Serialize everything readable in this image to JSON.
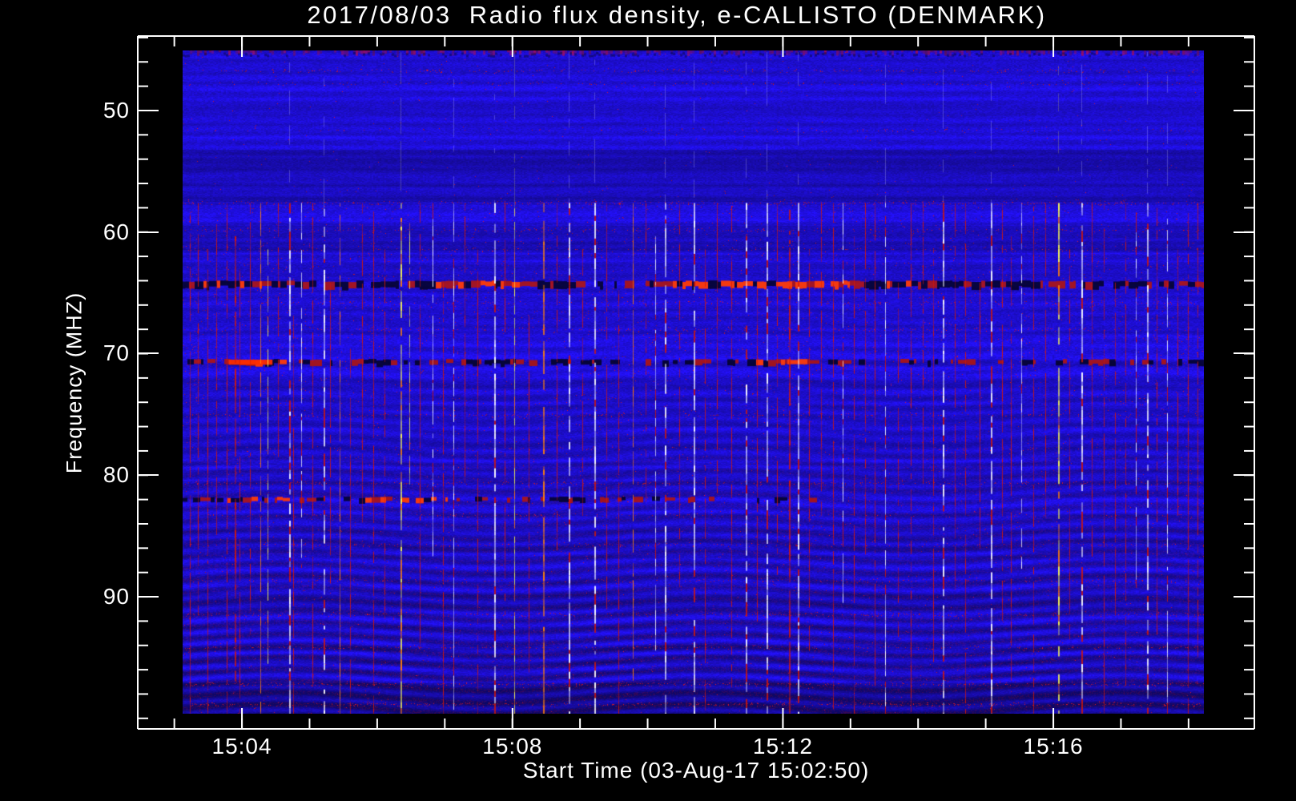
{
  "title": "2017/08/03  Radio flux density, e-CALLISTO (DENMARK)",
  "colors": {
    "background": "#000000",
    "foreground": "#ffffff",
    "base_blue": "#2012ee",
    "rfi_red": "#d71905",
    "rfi_orange": "#ff820a",
    "rfi_yellow": "#fcfc50",
    "rfi_white": "#ffffff"
  },
  "chart_data": {
    "type": "heatmap",
    "title": "2017/08/03  Radio flux density, e-CALLISTO (DENMARK)",
    "xlabel": "Start Time (03-Aug-17 15:02:50)",
    "ylabel": "Frequency (MHZ)",
    "instrument": "e-CALLISTO",
    "station": "DENMARK",
    "date": "2017/08/03",
    "start_time": "15:02:50",
    "grid": false,
    "legend": "none",
    "x_axis": {
      "major_ticks": [
        {
          "label": "15:04",
          "frac": 0.0933
        },
        {
          "label": "15:08",
          "frac": 0.3356
        },
        {
          "label": "15:12",
          "frac": 0.5778
        },
        {
          "label": "15:16",
          "frac": 0.82
        }
      ],
      "minor_step_frac": 0.060555,
      "minor_k_min": -1,
      "minor_k_max": 14,
      "minutes_per_minor": 1,
      "approx_time_span": [
        "15:02:28",
        "15:18:59"
      ]
    },
    "y_axis": {
      "unit": "MHz",
      "range_top_mhz": 44,
      "range_bottom_mhz": 101,
      "major_ticks": [
        {
          "label": "50",
          "frac": 0.1075
        },
        {
          "label": "60",
          "frac": 0.2832
        },
        {
          "label": "70",
          "frac": 0.4578
        },
        {
          "label": "80",
          "frac": 0.6335
        },
        {
          "label": "90",
          "frac": 0.8092
        }
      ],
      "minor_step_frac": 0.03509,
      "minor_k_min": -3,
      "minor_k_max": 25,
      "mhz_per_minor": 2
    },
    "colormap": "blue background, red/orange/yellow/white for strong flux",
    "features": {
      "interference_bands_mhz": [
        64.5,
        71.0,
        82.8
      ],
      "quiet_zone_mhz": [
        45,
        58
      ],
      "rfi_streaks": "many thin vertical broadband streaks between ~58 MHz and ~100 MHz",
      "texture": "wavy dark-blue interference fringes increasing toward high frequencies"
    }
  },
  "spectrogram": {
    "seed": 987654,
    "base_rgb": [
      34,
      16,
      242
    ],
    "streak_colors": {
      "red": [
        215,
        25,
        5
      ],
      "orange": [
        255,
        130,
        10
      ],
      "yellow": [
        252,
        252,
        80
      ],
      "white": [
        255,
        255,
        255
      ]
    },
    "bands": [
      {
        "y": 0.354,
        "h": 10,
        "strength": 1.0,
        "red_zones": [
          [
            0.02,
            0.09
          ],
          [
            0.24,
            0.33
          ],
          [
            0.47,
            0.62
          ],
          [
            0.63,
            0.74
          ]
        ]
      },
      {
        "y": 0.471,
        "h": 8,
        "strength": 0.75,
        "red_zones": [
          [
            0.04,
            0.1
          ],
          [
            0.55,
            0.62
          ]
        ],
        "bright_zone": [
          0.045,
          0.088
        ]
      },
      {
        "y": 0.678,
        "h": 7,
        "strength": 0.55,
        "limit_x": 0.62,
        "red_zones": [
          [
            0.0,
            0.26
          ]
        ]
      }
    ],
    "speckle_rows": [
      {
        "y": 0.03,
        "d": 0.06
      },
      {
        "y": 0.05,
        "d": 0.03
      },
      {
        "y": 0.12,
        "d": 0.025
      },
      {
        "y": 0.229,
        "d": 0.1
      },
      {
        "y": 0.27,
        "d": 0.05
      },
      {
        "y": 0.3,
        "d": 0.04
      },
      {
        "y": 0.38,
        "d": 0.05
      },
      {
        "y": 0.42,
        "d": 0.04
      },
      {
        "y": 0.55,
        "d": 0.05
      },
      {
        "y": 0.6,
        "d": 0.04
      },
      {
        "y": 0.652,
        "d": 0.07
      },
      {
        "y": 0.7,
        "d": 0.04
      },
      {
        "y": 0.745,
        "d": 0.05
      },
      {
        "y": 0.8,
        "d": 0.05
      },
      {
        "y": 0.85,
        "d": 0.06
      },
      {
        "y": 0.9,
        "d": 0.07
      },
      {
        "y": 0.955,
        "d": 0.1
      },
      {
        "y": 0.985,
        "d": 0.12
      }
    ],
    "dark_zones": [
      {
        "y0": 0.15,
        "y1": 0.228,
        "f": 0.84
      },
      {
        "y0": 0.265,
        "y1": 0.305,
        "f": 0.86
      },
      {
        "y0": 0.32,
        "y1": 0.347,
        "f": 0.88
      },
      {
        "y0": 0.955,
        "y1": 1.0,
        "f": 0.82
      }
    ],
    "streaks": [
      [
        0.007,
        "r",
        0.23,
        1.0,
        1
      ],
      [
        0.015,
        "r",
        0.23,
        0.85,
        1
      ],
      [
        0.024,
        "r",
        0.3,
        1.0,
        1
      ],
      [
        0.033,
        "r",
        0.23,
        0.72,
        1
      ],
      [
        0.043,
        "r",
        0.23,
        1.0,
        1
      ],
      [
        0.051,
        "r",
        0.28,
        0.95,
        2
      ],
      [
        0.056,
        "r",
        0.33,
        1.0,
        1
      ],
      [
        0.066,
        "r",
        0.23,
        0.88,
        1
      ],
      [
        0.076,
        "o",
        0.23,
        1.0,
        1
      ],
      [
        0.083,
        "y",
        0.3,
        0.92,
        1
      ],
      [
        0.093,
        "r",
        0.23,
        0.6,
        1
      ],
      [
        0.104,
        "w",
        0.23,
        1.0,
        2
      ],
      [
        0.108,
        "r",
        0.4,
        1.0,
        1
      ],
      [
        0.116,
        "w",
        0.23,
        0.78,
        1
      ],
      [
        0.127,
        "r",
        0.23,
        0.95,
        1
      ],
      [
        0.138,
        "w",
        0.23,
        1.0,
        2
      ],
      [
        0.144,
        "r",
        0.35,
        0.8,
        1
      ],
      [
        0.154,
        "o",
        0.23,
        1.0,
        1
      ],
      [
        0.164,
        "r",
        0.45,
        1.0,
        1
      ],
      [
        0.176,
        "r",
        0.23,
        0.7,
        1
      ],
      [
        0.187,
        "r",
        0.23,
        1.0,
        1
      ],
      [
        0.198,
        "r",
        0.3,
        0.85,
        1
      ],
      [
        0.213,
        "y",
        0.23,
        1.0,
        2
      ],
      [
        0.222,
        "y",
        0.26,
        0.65,
        1
      ],
      [
        0.232,
        "r",
        0.23,
        0.9,
        1
      ],
      [
        0.245,
        "w",
        0.23,
        0.75,
        1
      ],
      [
        0.255,
        "r",
        0.35,
        1.0,
        1
      ],
      [
        0.265,
        "w",
        0.23,
        1.0,
        1
      ],
      [
        0.276,
        "r",
        0.23,
        0.65,
        1
      ],
      [
        0.289,
        "r",
        0.3,
        1.0,
        1
      ],
      [
        0.305,
        "w",
        0.23,
        1.0,
        2
      ],
      [
        0.315,
        "r",
        0.23,
        0.85,
        1
      ],
      [
        0.325,
        "y",
        0.23,
        1.0,
        1
      ],
      [
        0.339,
        "r",
        0.4,
        0.95,
        1
      ],
      [
        0.353,
        "o",
        0.23,
        1.0,
        2
      ],
      [
        0.366,
        "r",
        0.23,
        0.75,
        1
      ],
      [
        0.378,
        "w",
        0.23,
        1.0,
        2
      ],
      [
        0.391,
        "r",
        0.3,
        0.7,
        1
      ],
      [
        0.403,
        "w",
        0.23,
        1.0,
        2
      ],
      [
        0.415,
        "r",
        0.23,
        0.88,
        1
      ],
      [
        0.427,
        "r",
        0.35,
        1.0,
        1
      ],
      [
        0.441,
        "o",
        0.23,
        0.95,
        1
      ],
      [
        0.453,
        "r",
        0.23,
        0.68,
        1
      ],
      [
        0.463,
        "w",
        0.28,
        0.9,
        1
      ],
      [
        0.472,
        "w",
        0.23,
        1.0,
        2
      ],
      [
        0.486,
        "r",
        0.23,
        0.8,
        1
      ],
      [
        0.5,
        "w",
        0.23,
        1.0,
        2
      ],
      [
        0.511,
        "r",
        0.3,
        1.0,
        1
      ],
      [
        0.523,
        "r",
        0.23,
        0.72,
        1
      ],
      [
        0.537,
        "r",
        0.23,
        0.95,
        1
      ],
      [
        0.551,
        "w",
        0.23,
        1.0,
        2
      ],
      [
        0.562,
        "r",
        0.35,
        0.85,
        1
      ],
      [
        0.572,
        "w",
        0.23,
        1.0,
        2
      ],
      [
        0.582,
        "r",
        0.23,
        0.78,
        1
      ],
      [
        0.594,
        "r",
        0.23,
        1.0,
        2
      ],
      [
        0.602,
        "w",
        0.23,
        1.0,
        2
      ],
      [
        0.613,
        "r",
        0.3,
        0.9,
        1
      ],
      [
        0.625,
        "r",
        0.23,
        0.7,
        1
      ],
      [
        0.637,
        "r",
        0.23,
        1.0,
        1
      ],
      [
        0.646,
        "w",
        0.23,
        0.82,
        1
      ],
      [
        0.657,
        "r",
        0.28,
        1.0,
        1
      ],
      [
        0.668,
        "r",
        0.23,
        0.75,
        1
      ],
      [
        0.678,
        "r",
        0.23,
        0.95,
        1
      ],
      [
        0.688,
        "w",
        0.23,
        1.0,
        1
      ],
      [
        0.7,
        "r",
        0.35,
        0.88,
        1
      ],
      [
        0.713,
        "r",
        0.23,
        1.0,
        1
      ],
      [
        0.725,
        "r",
        0.23,
        0.65,
        1
      ],
      [
        0.735,
        "r",
        0.3,
        0.92,
        1
      ],
      [
        0.744,
        "w",
        0.23,
        1.0,
        2
      ],
      [
        0.756,
        "r",
        0.23,
        0.8,
        1
      ],
      [
        0.766,
        "r",
        0.23,
        1.0,
        1
      ],
      [
        0.78,
        "r",
        0.35,
        0.75,
        1
      ],
      [
        0.791,
        "w",
        0.23,
        1.0,
        2
      ],
      [
        0.802,
        "r",
        0.23,
        0.85,
        1
      ],
      [
        0.811,
        "r",
        0.28,
        0.95,
        1
      ],
      [
        0.821,
        "w",
        0.23,
        0.78,
        1
      ],
      [
        0.833,
        "r",
        0.23,
        1.0,
        1
      ],
      [
        0.845,
        "r",
        0.23,
        0.7,
        1
      ],
      [
        0.857,
        "y",
        0.23,
        1.0,
        2
      ],
      [
        0.868,
        "r",
        0.3,
        0.88,
        1
      ],
      [
        0.88,
        "w",
        0.23,
        1.0,
        2
      ],
      [
        0.89,
        "r",
        0.23,
        0.75,
        1
      ],
      [
        0.902,
        "r",
        0.23,
        1.0,
        1
      ],
      [
        0.913,
        "r",
        0.35,
        0.85,
        1
      ],
      [
        0.923,
        "r",
        0.23,
        0.95,
        1
      ],
      [
        0.933,
        "w",
        0.23,
        0.8,
        1
      ],
      [
        0.944,
        "w",
        0.23,
        1.0,
        2
      ],
      [
        0.954,
        "r",
        0.23,
        0.88,
        1
      ],
      [
        0.964,
        "w",
        0.23,
        1.0,
        1
      ],
      [
        0.974,
        "r",
        0.3,
        0.7,
        1
      ],
      [
        0.984,
        "r",
        0.23,
        1.0,
        1
      ],
      [
        0.994,
        "r",
        0.23,
        0.9,
        1
      ]
    ]
  }
}
